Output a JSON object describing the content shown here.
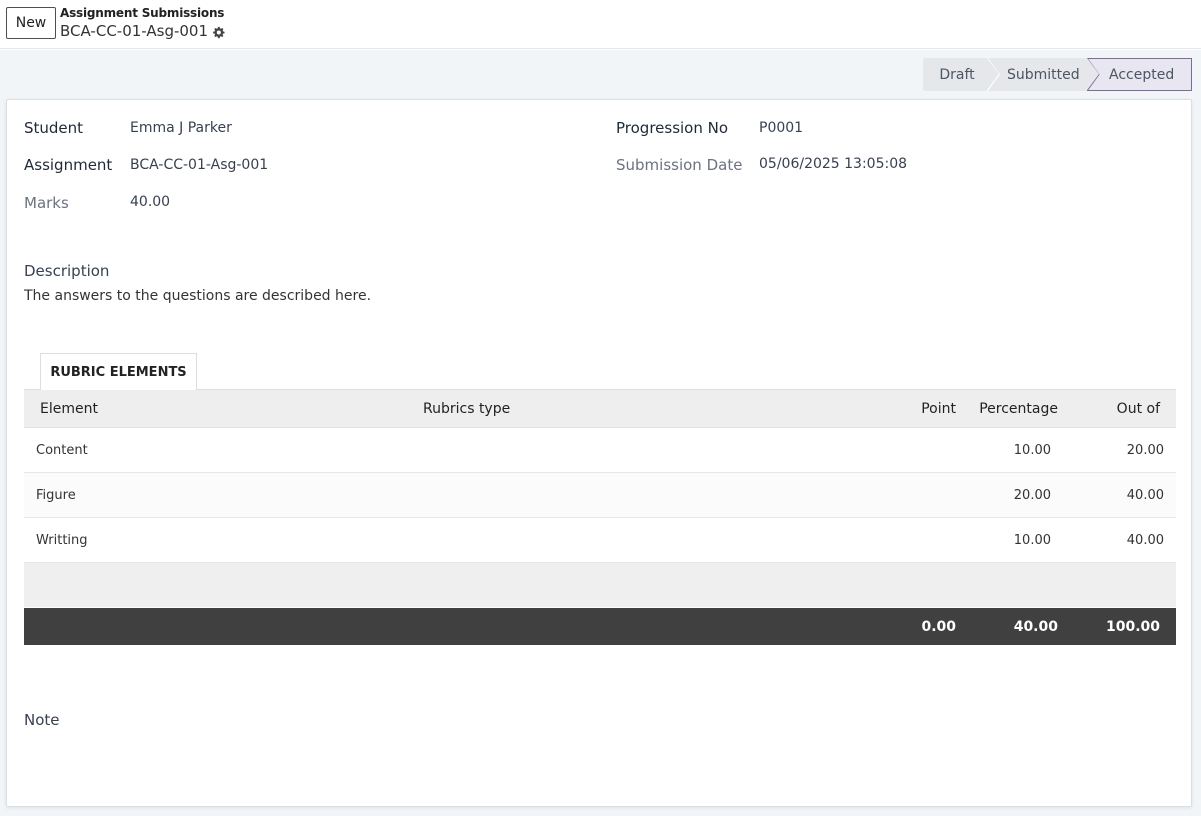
{
  "control_panel": {
    "new_button": "New",
    "breadcrumb_parent": "Assignment Submissions",
    "record_name": "BCA-CC-01-Asg-001"
  },
  "statusbar": {
    "stages": [
      "Draft",
      "Submitted",
      "Accepted"
    ],
    "active": "Accepted"
  },
  "form": {
    "student_label": "Student",
    "student_value": "Emma J Parker",
    "assignment_label": "Assignment",
    "assignment_value": "BCA-CC-01-Asg-001",
    "marks_label": "Marks",
    "marks_value": "40.00",
    "progression_label": "Progression No",
    "progression_value": "P0001",
    "submission_date_label": "Submission Date",
    "submission_date_value": "05/06/2025 13:05:08",
    "description_label": "Description",
    "description_value": "The answers to the questions are described here.",
    "note_label": "Note"
  },
  "tabs": [
    {
      "label": "RUBRIC ELEMENTS"
    }
  ],
  "table": {
    "headers": {
      "element": "Element",
      "rubrics_type": "Rubrics type",
      "point": "Point",
      "percentage": "Percentage",
      "out_of": "Out of"
    },
    "rows": [
      {
        "element": "Content",
        "rubrics_type": "",
        "point": "",
        "percentage": "10.00",
        "out_of": "20.00"
      },
      {
        "element": "Figure",
        "rubrics_type": "",
        "point": "",
        "percentage": "20.00",
        "out_of": "40.00"
      },
      {
        "element": "Writting",
        "rubrics_type": "",
        "point": "",
        "percentage": "10.00",
        "out_of": "40.00"
      }
    ],
    "totals": {
      "point": "0.00",
      "percentage": "40.00",
      "out_of": "100.00"
    }
  },
  "colors": {
    "accent": "#7c6b96",
    "footer": "#404040"
  }
}
